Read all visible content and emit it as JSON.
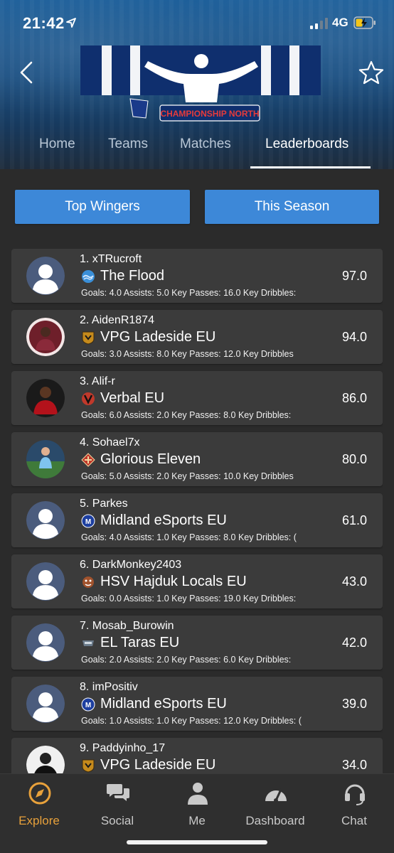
{
  "status": {
    "time": "21:42",
    "network": "4G"
  },
  "header": {
    "banner_text": "CHAMPIONSHIP NORTH",
    "tabs": [
      {
        "label": "Home"
      },
      {
        "label": "Teams"
      },
      {
        "label": "Matches"
      },
      {
        "label": "Leaderboards"
      }
    ],
    "active_tab": "Leaderboards"
  },
  "filters": {
    "category": "Top Wingers",
    "period": "This Season"
  },
  "leaderboard": [
    {
      "player": "1. xTRucroft",
      "team": "The Flood",
      "stats": "Goals: 4.0  Assists: 5.0  Key Passes: 16.0  Key Dribbles:",
      "score": "97.0",
      "avatar": "default",
      "logo": "flood-logo"
    },
    {
      "player": "2. AidenR1874",
      "team": "VPG Ladeside EU",
      "stats": "Goals: 3.0  Assists: 8.0  Key Passes: 12.0  Key Dribbles",
      "score": "94.0",
      "avatar": "photo",
      "logo": "ladeside-logo"
    },
    {
      "player": "3. Alif-r",
      "team": "Verbal EU",
      "stats": "Goals: 6.0  Assists: 2.0  Key Passes: 8.0  Key Dribbles:",
      "score": "86.0",
      "avatar": "photo",
      "logo": "verbal-logo"
    },
    {
      "player": "4. Sohael7x",
      "team": "Glorious Eleven",
      "stats": "Goals: 5.0  Assists: 2.0  Key Passes: 10.0  Key Dribbles",
      "score": "80.0",
      "avatar": "photo",
      "logo": "glorious-logo"
    },
    {
      "player": "5. Parkes",
      "team": "Midland eSports EU",
      "stats": "Goals: 4.0  Assists: 1.0  Key Passes: 8.0  Key Dribbles: (",
      "score": "61.0",
      "avatar": "default",
      "logo": "midland-logo"
    },
    {
      "player": "6. DarkMonkey2403",
      "team": "HSV Hajduk Locals EU",
      "stats": "Goals: 0.0  Assists: 1.0  Key Passes: 19.0  Key Dribbles:",
      "score": "43.0",
      "avatar": "default",
      "logo": "hajduk-logo"
    },
    {
      "player": "7. Mosab_Burowin",
      "team": "EL Taras EU",
      "stats": "Goals: 2.0  Assists: 2.0  Key Passes: 6.0  Key Dribbles:",
      "score": "42.0",
      "avatar": "default",
      "logo": "taras-logo"
    },
    {
      "player": "8. imPositiv",
      "team": "Midland eSports EU",
      "stats": "Goals: 1.0  Assists: 1.0  Key Passes: 12.0  Key Dribbles: (",
      "score": "39.0",
      "avatar": "default",
      "logo": "midland-logo"
    },
    {
      "player": "9. Paddyinho_17",
      "team": "VPG Ladeside EU",
      "stats": "",
      "score": "34.0",
      "avatar": "photo",
      "logo": "ladeside-logo"
    }
  ],
  "bottom_nav": [
    {
      "label": "Explore",
      "icon": "compass-icon"
    },
    {
      "label": "Social",
      "icon": "chat-bubbles-icon"
    },
    {
      "label": "Me",
      "icon": "person-icon"
    },
    {
      "label": "Dashboard",
      "icon": "gauge-icon"
    },
    {
      "label": "Chat",
      "icon": "headset-icon"
    }
  ],
  "active_nav": "Explore",
  "colors": {
    "accent": "#3d88d8",
    "active_nav": "#e8a13b",
    "row_bg": "#3b3b3b",
    "page_bg": "#2b2b2b"
  }
}
